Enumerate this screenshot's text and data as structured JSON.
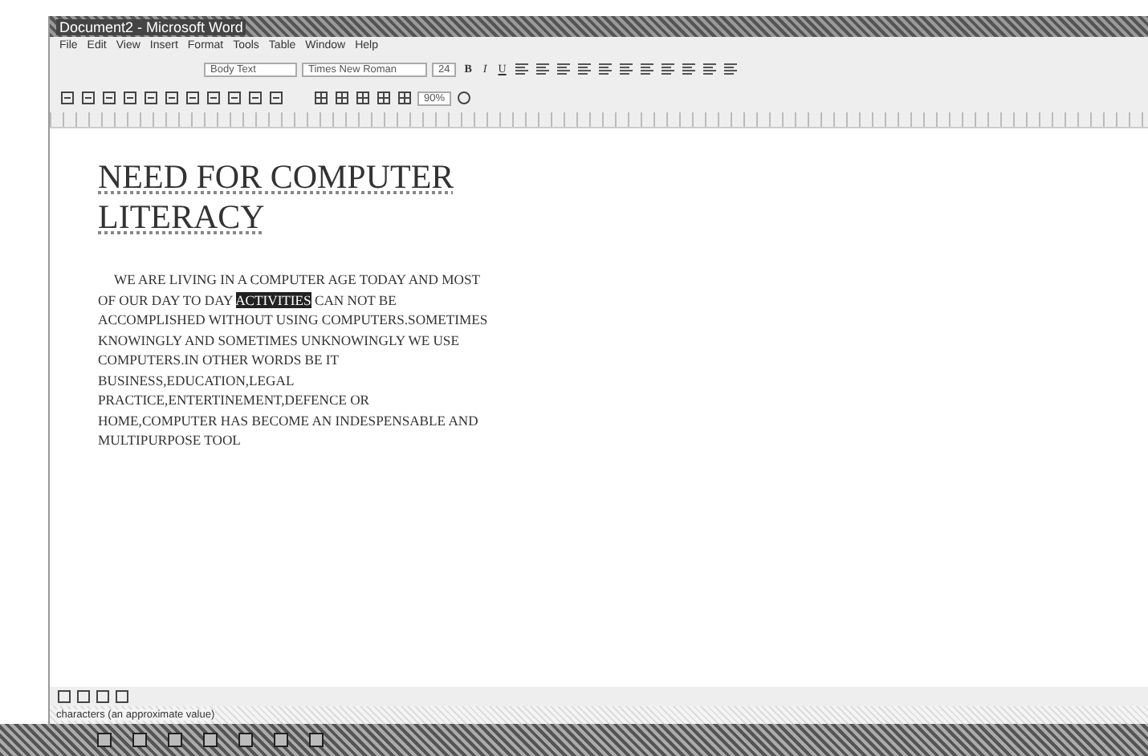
{
  "window": {
    "title": "Document2 - Microsoft Word"
  },
  "menu": [
    "File",
    "Edit",
    "View",
    "Insert",
    "Format",
    "Tools",
    "Table",
    "Window",
    "Help"
  ],
  "formatting": {
    "style": "Body Text",
    "font": "Times New Roman",
    "size": "24",
    "buttons": [
      "B",
      "I",
      "U"
    ]
  },
  "standard": {
    "zoom": "90%"
  },
  "document": {
    "heading": "NEED FOR  COMPUTER LITERACY",
    "paragraph": [
      {
        "text": "WE ARE LIVING IN A COMPUTER AGE TODAY AND MOST OF OUR DAY TO DAY ",
        "selected": false
      },
      {
        "text": "ACTIVITIES",
        "selected": true
      },
      {
        "text": " CAN NOT BE ACCOMPLISHED WITHOUT USING COMPUTERS.SOMETIMES KNOWINGLY AND SOMETIMES UNKNOWINGLY WE USE COMPUTERS.IN OTHER WORDS BE IT BUSINESS,EDUCATION,LEGAL PRACTICE,ENTERTINEMENT,DEFENCE OR HOME,COMPUTER HAS BECOME AN INDESPENSABLE AND MULTIPURPOSE TOOL",
        "selected": false
      }
    ]
  },
  "status_bar": {
    "text": "characters (an approximate value)"
  }
}
